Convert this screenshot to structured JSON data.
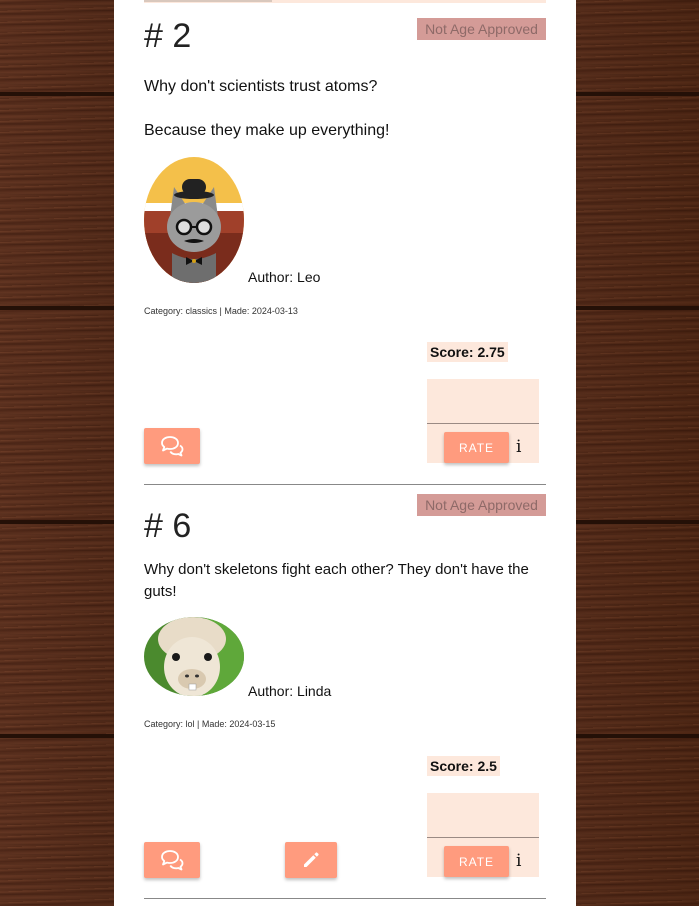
{
  "jokes": [
    {
      "number": "# 2",
      "age_badge": "Not Age Approved",
      "lines": [
        "Why don't scientists trust atoms?",
        "Because they make up everything!"
      ],
      "author": "Author: Leo",
      "meta": "Category: classics | Made: 2024-03-13",
      "score": "Score: 2.75",
      "rate_label": "RATE",
      "info": "i",
      "avatar_icon": "cat-with-hat-avatar-icon",
      "comment_icon": "comments-icon"
    },
    {
      "number": "# 6",
      "age_badge": "Not Age Approved",
      "lines": [
        "Why don't skeletons fight each other? They don't have the guts!"
      ],
      "author": "Author: Linda",
      "meta": "Category: lol | Made: 2024-03-15",
      "score": "Score: 2.5",
      "rate_label": "RATE",
      "info": "i",
      "avatar_icon": "alpaca-avatar-icon",
      "comment_icon": "comments-icon",
      "edit_icon": "pencil-icon"
    }
  ],
  "colors": {
    "accent": "#ff9b7e",
    "badge": "#d49b97",
    "score_bg": "#fde8dc"
  }
}
